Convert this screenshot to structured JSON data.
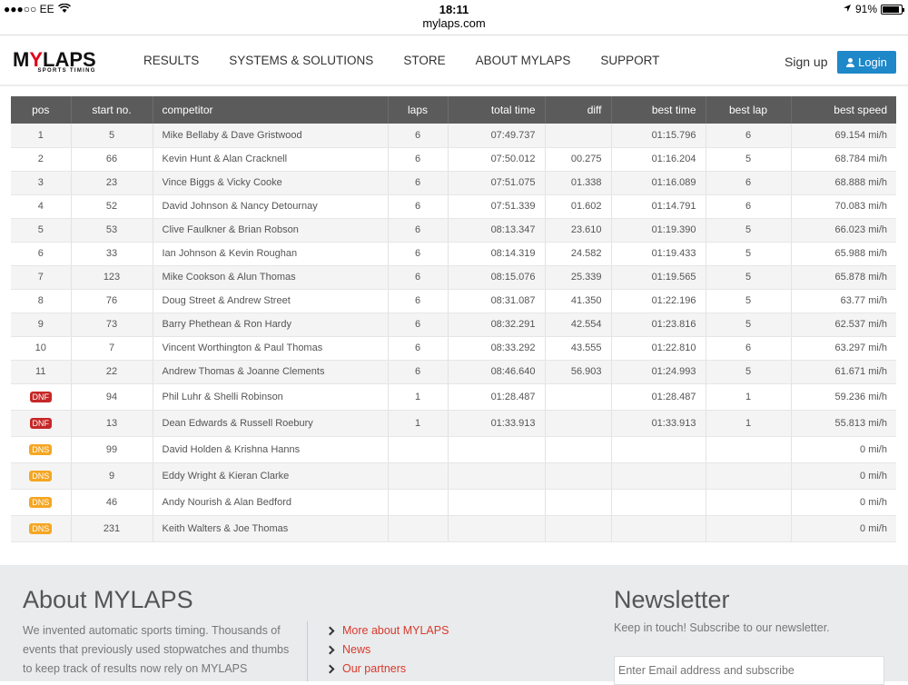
{
  "status_bar": {
    "carrier": "●●●○○ EE",
    "time": "18:11",
    "battery": "91%",
    "battery_level": 0.91,
    "url": "mylaps.com"
  },
  "header": {
    "logo_word": "MYLAPS",
    "logo_tag": "SPORTS TIMING",
    "nav": [
      "RESULTS",
      "SYSTEMS & SOLUTIONS",
      "STORE",
      "ABOUT MYLAPS",
      "SUPPORT"
    ],
    "signup": "Sign up",
    "login": "Login"
  },
  "table": {
    "columns": [
      "pos",
      "start no.",
      "competitor",
      "laps",
      "total time",
      "diff",
      "best time",
      "best lap",
      "best speed"
    ],
    "rows": [
      {
        "pos": "1",
        "start": "5",
        "competitor": "Mike Bellaby & Dave Gristwood",
        "laps": "6",
        "total": "07:49.737",
        "diff": "",
        "best_time": "01:15.796",
        "best_lap": "6",
        "speed": "69.154 mi/h"
      },
      {
        "pos": "2",
        "start": "66",
        "competitor": "Kevin Hunt & Alan Cracknell",
        "laps": "6",
        "total": "07:50.012",
        "diff": "00.275",
        "best_time": "01:16.204",
        "best_lap": "5",
        "speed": "68.784 mi/h"
      },
      {
        "pos": "3",
        "start": "23",
        "competitor": "Vince Biggs & Vicky Cooke",
        "laps": "6",
        "total": "07:51.075",
        "diff": "01.338",
        "best_time": "01:16.089",
        "best_lap": "6",
        "speed": "68.888 mi/h"
      },
      {
        "pos": "4",
        "start": "52",
        "competitor": "David Johnson & Nancy Detournay",
        "laps": "6",
        "total": "07:51.339",
        "diff": "01.602",
        "best_time": "01:14.791",
        "best_lap": "6",
        "speed": "70.083 mi/h"
      },
      {
        "pos": "5",
        "start": "53",
        "competitor": "Clive Faulkner & Brian Robson",
        "laps": "6",
        "total": "08:13.347",
        "diff": "23.610",
        "best_time": "01:19.390",
        "best_lap": "5",
        "speed": "66.023 mi/h"
      },
      {
        "pos": "6",
        "start": "33",
        "competitor": "Ian Johnson & Kevin Roughan",
        "laps": "6",
        "total": "08:14.319",
        "diff": "24.582",
        "best_time": "01:19.433",
        "best_lap": "5",
        "speed": "65.988 mi/h"
      },
      {
        "pos": "7",
        "start": "123",
        "competitor": "Mike Cookson & Alun Thomas",
        "laps": "6",
        "total": "08:15.076",
        "diff": "25.339",
        "best_time": "01:19.565",
        "best_lap": "5",
        "speed": "65.878 mi/h"
      },
      {
        "pos": "8",
        "start": "76",
        "competitor": "Doug Street & Andrew Street",
        "laps": "6",
        "total": "08:31.087",
        "diff": "41.350",
        "best_time": "01:22.196",
        "best_lap": "5",
        "speed": "63.77 mi/h"
      },
      {
        "pos": "9",
        "start": "73",
        "competitor": "Barry Phethean & Ron Hardy",
        "laps": "6",
        "total": "08:32.291",
        "diff": "42.554",
        "best_time": "01:23.816",
        "best_lap": "5",
        "speed": "62.537 mi/h"
      },
      {
        "pos": "10",
        "start": "7",
        "competitor": "Vincent Worthington & Paul Thomas",
        "laps": "6",
        "total": "08:33.292",
        "diff": "43.555",
        "best_time": "01:22.810",
        "best_lap": "6",
        "speed": "63.297 mi/h"
      },
      {
        "pos": "11",
        "start": "22",
        "competitor": "Andrew Thomas & Joanne Clements",
        "laps": "6",
        "total": "08:46.640",
        "diff": "56.903",
        "best_time": "01:24.993",
        "best_lap": "5",
        "speed": "61.671 mi/h"
      },
      {
        "pos": "DNF",
        "start": "94",
        "competitor": "Phil Luhr & Shelli Robinson",
        "laps": "1",
        "total": "01:28.487",
        "diff": "",
        "best_time": "01:28.487",
        "best_lap": "1",
        "speed": "59.236 mi/h"
      },
      {
        "pos": "DNF",
        "start": "13",
        "competitor": "Dean Edwards & Russell Roebury",
        "laps": "1",
        "total": "01:33.913",
        "diff": "",
        "best_time": "01:33.913",
        "best_lap": "1",
        "speed": "55.813 mi/h"
      },
      {
        "pos": "DNS",
        "start": "99",
        "competitor": "David Holden & Krishna Hanns",
        "laps": "",
        "total": "",
        "diff": "",
        "best_time": "",
        "best_lap": "",
        "speed": "0 mi/h"
      },
      {
        "pos": "DNS",
        "start": "9",
        "competitor": "Eddy Wright & Kieran Clarke",
        "laps": "",
        "total": "",
        "diff": "",
        "best_time": "",
        "best_lap": "",
        "speed": "0 mi/h"
      },
      {
        "pos": "DNS",
        "start": "46",
        "competitor": "Andy Nourish & Alan Bedford",
        "laps": "",
        "total": "",
        "diff": "",
        "best_time": "",
        "best_lap": "",
        "speed": "0 mi/h"
      },
      {
        "pos": "DNS",
        "start": "231",
        "competitor": "Keith Walters & Joe Thomas",
        "laps": "",
        "total": "",
        "diff": "",
        "best_time": "",
        "best_lap": "",
        "speed": "0 mi/h"
      }
    ]
  },
  "footer": {
    "about_title": "About MYLAPS",
    "about_text": "We invented automatic sports timing. Thousands of events that previously used stopwatches and thumbs to keep track of results now rely on MYLAPS",
    "links": [
      "More about MYLAPS",
      "News",
      "Our partners"
    ],
    "newsletter_title": "Newsletter",
    "newsletter_text": "Keep in touch! Subscribe to our newsletter.",
    "newsletter_placeholder": "Enter Email address and subscribe"
  },
  "colors": {
    "accent_red": "#d9392b",
    "login_blue": "#1e88c9",
    "dnf": "#c62828",
    "dns": "#f5a623",
    "table_header": "#5b5b5b"
  }
}
